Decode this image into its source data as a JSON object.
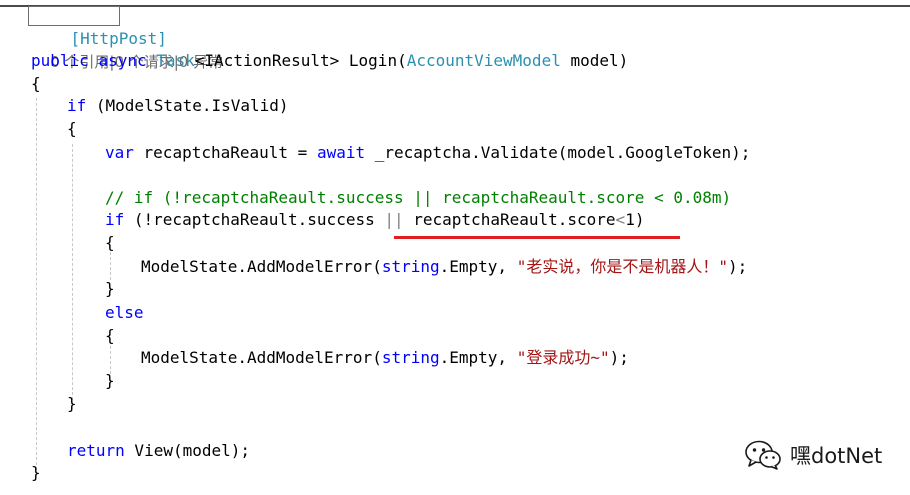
{
  "code": {
    "attribute": "[HttpPost]",
    "codelens": "0 个引用|0 个请求|0 异常",
    "signature": {
      "kw_public": "public",
      "kw_async": "async",
      "type_task": "Task",
      "generic_open": "<IActionResult> Login(",
      "type_model": "AccountViewModel",
      "param": " model)"
    },
    "brace_open_outer": "{",
    "if1": {
      "kw": "if",
      "rest": " (ModelState.IsValid)"
    },
    "brace_open_if1": "{",
    "var_line": {
      "kw_var": "var",
      "mid": " recaptchaReault = ",
      "kw_await": "await",
      "rest": " _recaptcha.Validate(model.GoogleToken);"
    },
    "comment_line": "// if (!recaptchaReault.success || recaptchaReault.score < 0.08m)",
    "if2": {
      "kw": "if",
      "rest_a": " (!recaptchaReault.success ",
      "op": "||",
      "rest_b": " recaptchaReault.score",
      "lt": "<",
      "rest_c": "1)"
    },
    "brace_open_if2": "{",
    "error1": {
      "pre": "ModelState.AddModelError(",
      "kw_string": "string",
      "mid": ".Empty, ",
      "str": "\"老实说，你是不是机器人！\"",
      "post": ");"
    },
    "brace_close_if2": "}",
    "else_kw": "else",
    "brace_open_else": "{",
    "error2": {
      "pre": "ModelState.AddModelError(",
      "kw_string": "string",
      "mid": ".Empty, ",
      "str": "\"登录成功~\"",
      "post": ");"
    },
    "brace_close_else": "}",
    "brace_close_if1": "}",
    "return_line": {
      "kw": "return",
      "rest": " View(model);"
    },
    "brace_close_outer": "}"
  },
  "watermark": {
    "icon": "wechat-icon",
    "text": "嘿dotNet"
  },
  "colors": {
    "keyword": "#0000ff",
    "type": "#2b91af",
    "string": "#a31515",
    "comment": "#008000",
    "highlight_underline": "#e02020"
  }
}
